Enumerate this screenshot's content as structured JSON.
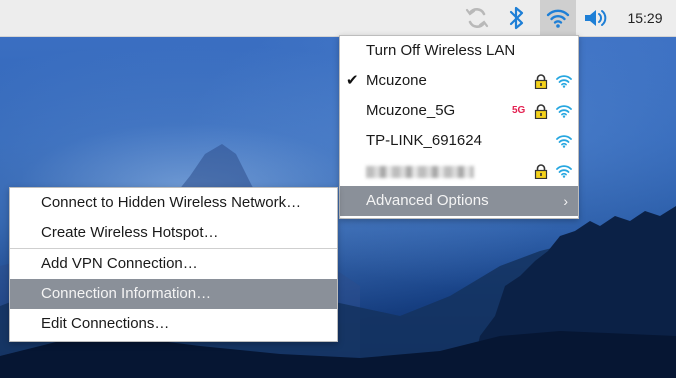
{
  "panel": {
    "clock": "15:29",
    "icons": [
      "sync-icon",
      "bluetooth-icon",
      "wifi-icon",
      "volume-icon"
    ]
  },
  "wifi_menu": {
    "turn_off_label": "Turn Off Wireless LAN",
    "networks": [
      {
        "ssid": "Mcuzone",
        "connected": true,
        "secured": true,
        "band_5g": false
      },
      {
        "ssid": "Mcuzone_5G",
        "connected": false,
        "secured": true,
        "band_5g": true,
        "band_label": "5G"
      },
      {
        "ssid": "TP-LINK_691624",
        "connected": false,
        "secured": false,
        "band_5g": false
      },
      {
        "ssid": "",
        "connected": false,
        "secured": true,
        "band_5g": false,
        "obscured": true
      }
    ],
    "checkmark": "✔",
    "advanced_label": "Advanced Options",
    "advanced_arrow": "›"
  },
  "advanced_menu": {
    "items": [
      {
        "label": "Connect to Hidden Wireless Network…"
      },
      {
        "label": "Create Wireless Hotspot…"
      },
      {
        "label": "Add VPN Connection…"
      },
      {
        "label": "Connection Information…",
        "highlighted": true
      },
      {
        "label": "Edit Connections…"
      }
    ]
  },
  "colors": {
    "accent_blue": "#1e7fd6",
    "highlight": "#8a9099",
    "lock_yellow": "#f4d21c",
    "badge_5g": "#e32050"
  }
}
